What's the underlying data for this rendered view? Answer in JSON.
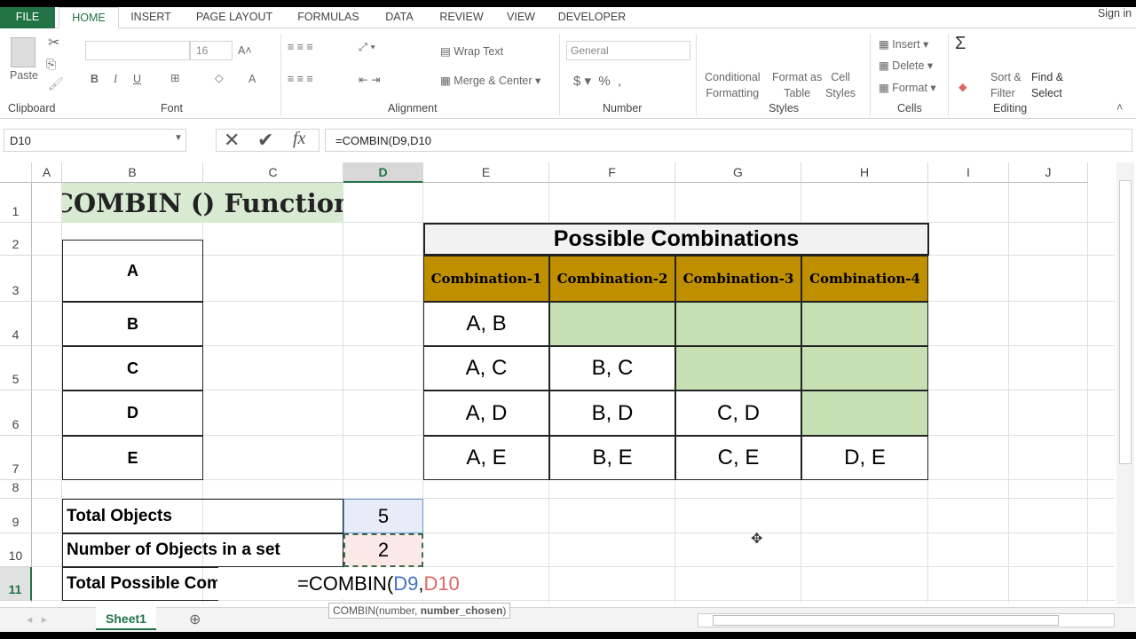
{
  "ribbon_tabs": [
    "FILE",
    "HOME",
    "INSERT",
    "PAGE LAYOUT",
    "FORMULAS",
    "DATA",
    "REVIEW",
    "VIEW",
    "DEVELOPER"
  ],
  "active_tab": "HOME",
  "sign_in": "Sign in",
  "ribbon": {
    "paste": "Paste",
    "font_size": "16",
    "wrap_text": "Wrap Text",
    "merge_center": "Merge & Center",
    "number_format": "General",
    "conditional_formatting": [
      "Conditional",
      "Formatting"
    ],
    "format_as_table": [
      "Format as",
      "Table"
    ],
    "cell_styles": [
      "Cell",
      "Styles"
    ],
    "insert": "Insert",
    "delete": "Delete",
    "format": "Format",
    "sort_filter": [
      "Sort &",
      "Filter"
    ],
    "find_select": [
      "Find &",
      "Select"
    ],
    "groups": [
      "Clipboard",
      "Font",
      "Alignment",
      "Number",
      "Styles",
      "Cells",
      "Editing"
    ]
  },
  "name_box": "D10",
  "formula": "=COMBIN(D9,D10",
  "columns": [
    "A",
    "B",
    "C",
    "D",
    "E",
    "F",
    "G",
    "H",
    "I",
    "J"
  ],
  "selected_column": "D",
  "rows": [
    "1",
    "2",
    "3",
    "4",
    "5",
    "6",
    "7",
    "8",
    "9",
    "10",
    "11"
  ],
  "selected_row": "11",
  "cells": [
    {
      "ref": "B1",
      "text": "COMBIN () Function"
    },
    {
      "ref": "E2",
      "text": "Possible Combinations"
    },
    {
      "ref": "E3",
      "text": "Combination-1"
    },
    {
      "ref": "F3",
      "text": "Combination-2"
    },
    {
      "ref": "G3",
      "text": "Combination-3"
    },
    {
      "ref": "H3",
      "text": "Combination-4"
    },
    {
      "ref": "B3",
      "text": "A"
    },
    {
      "ref": "B4",
      "text": "B"
    },
    {
      "ref": "B5",
      "text": "C"
    },
    {
      "ref": "B6",
      "text": "D"
    },
    {
      "ref": "B7",
      "text": "E"
    },
    {
      "ref": "E4",
      "text": "A, B"
    },
    {
      "ref": "F4",
      "text": ""
    },
    {
      "ref": "G4",
      "text": ""
    },
    {
      "ref": "H4",
      "text": ""
    },
    {
      "ref": "E5",
      "text": "A, C"
    },
    {
      "ref": "F5",
      "text": "B, C"
    },
    {
      "ref": "G5",
      "text": ""
    },
    {
      "ref": "H5",
      "text": ""
    },
    {
      "ref": "E6",
      "text": "A, D"
    },
    {
      "ref": "F6",
      "text": "B, D"
    },
    {
      "ref": "G6",
      "text": "C, D"
    },
    {
      "ref": "H6",
      "text": ""
    },
    {
      "ref": "E7",
      "text": "A, E"
    },
    {
      "ref": "F7",
      "text": "B, E"
    },
    {
      "ref": "G7",
      "text": "C, E"
    },
    {
      "ref": "H7",
      "text": "D, E"
    },
    {
      "ref": "B9",
      "text": "Total Objects"
    },
    {
      "ref": "D9",
      "text": "5"
    },
    {
      "ref": "B10",
      "text": "Number of Objects in a set"
    },
    {
      "ref": "D10",
      "text": "2"
    },
    {
      "ref": "B11",
      "text": "Total Possible Com"
    }
  ],
  "in_cell_edit": {
    "prefix": "=COMBIN(",
    "arg1": "D9",
    "sep": ",",
    "arg2": "D10"
  },
  "tooltip": {
    "fn": "COMBIN(number, ",
    "bold_arg": "number_chosen",
    ")": ")",
    "close": ")"
  },
  "sheet_tabs": [
    "Sheet1"
  ],
  "colors": {
    "accent": "#217346",
    "header_fill": "#bf8f00",
    "title_fill": "#d9ead3",
    "empty_fill": "#c6e0b4",
    "ref1": "#4472c4",
    "ref2": "#e06666"
  }
}
